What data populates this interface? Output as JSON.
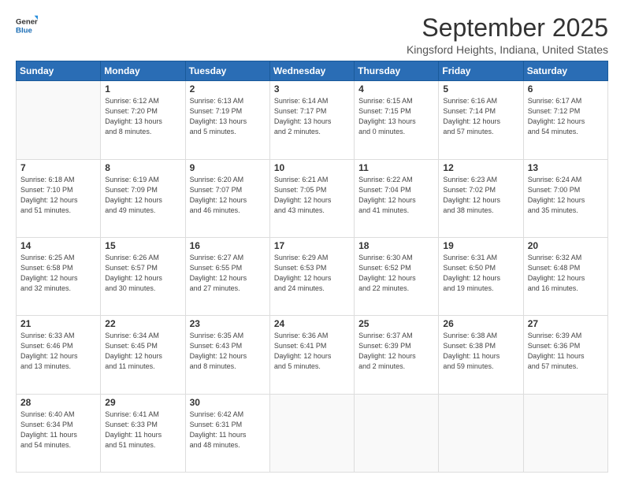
{
  "header": {
    "logo_line1": "General",
    "logo_line2": "Blue",
    "month": "September 2025",
    "location": "Kingsford Heights, Indiana, United States"
  },
  "weekdays": [
    "Sunday",
    "Monday",
    "Tuesday",
    "Wednesday",
    "Thursday",
    "Friday",
    "Saturday"
  ],
  "weeks": [
    [
      {
        "day": "",
        "info": ""
      },
      {
        "day": "1",
        "info": "Sunrise: 6:12 AM\nSunset: 7:20 PM\nDaylight: 13 hours\nand 8 minutes."
      },
      {
        "day": "2",
        "info": "Sunrise: 6:13 AM\nSunset: 7:19 PM\nDaylight: 13 hours\nand 5 minutes."
      },
      {
        "day": "3",
        "info": "Sunrise: 6:14 AM\nSunset: 7:17 PM\nDaylight: 13 hours\nand 2 minutes."
      },
      {
        "day": "4",
        "info": "Sunrise: 6:15 AM\nSunset: 7:15 PM\nDaylight: 13 hours\nand 0 minutes."
      },
      {
        "day": "5",
        "info": "Sunrise: 6:16 AM\nSunset: 7:14 PM\nDaylight: 12 hours\nand 57 minutes."
      },
      {
        "day": "6",
        "info": "Sunrise: 6:17 AM\nSunset: 7:12 PM\nDaylight: 12 hours\nand 54 minutes."
      }
    ],
    [
      {
        "day": "7",
        "info": "Sunrise: 6:18 AM\nSunset: 7:10 PM\nDaylight: 12 hours\nand 51 minutes."
      },
      {
        "day": "8",
        "info": "Sunrise: 6:19 AM\nSunset: 7:09 PM\nDaylight: 12 hours\nand 49 minutes."
      },
      {
        "day": "9",
        "info": "Sunrise: 6:20 AM\nSunset: 7:07 PM\nDaylight: 12 hours\nand 46 minutes."
      },
      {
        "day": "10",
        "info": "Sunrise: 6:21 AM\nSunset: 7:05 PM\nDaylight: 12 hours\nand 43 minutes."
      },
      {
        "day": "11",
        "info": "Sunrise: 6:22 AM\nSunset: 7:04 PM\nDaylight: 12 hours\nand 41 minutes."
      },
      {
        "day": "12",
        "info": "Sunrise: 6:23 AM\nSunset: 7:02 PM\nDaylight: 12 hours\nand 38 minutes."
      },
      {
        "day": "13",
        "info": "Sunrise: 6:24 AM\nSunset: 7:00 PM\nDaylight: 12 hours\nand 35 minutes."
      }
    ],
    [
      {
        "day": "14",
        "info": "Sunrise: 6:25 AM\nSunset: 6:58 PM\nDaylight: 12 hours\nand 32 minutes."
      },
      {
        "day": "15",
        "info": "Sunrise: 6:26 AM\nSunset: 6:57 PM\nDaylight: 12 hours\nand 30 minutes."
      },
      {
        "day": "16",
        "info": "Sunrise: 6:27 AM\nSunset: 6:55 PM\nDaylight: 12 hours\nand 27 minutes."
      },
      {
        "day": "17",
        "info": "Sunrise: 6:29 AM\nSunset: 6:53 PM\nDaylight: 12 hours\nand 24 minutes."
      },
      {
        "day": "18",
        "info": "Sunrise: 6:30 AM\nSunset: 6:52 PM\nDaylight: 12 hours\nand 22 minutes."
      },
      {
        "day": "19",
        "info": "Sunrise: 6:31 AM\nSunset: 6:50 PM\nDaylight: 12 hours\nand 19 minutes."
      },
      {
        "day": "20",
        "info": "Sunrise: 6:32 AM\nSunset: 6:48 PM\nDaylight: 12 hours\nand 16 minutes."
      }
    ],
    [
      {
        "day": "21",
        "info": "Sunrise: 6:33 AM\nSunset: 6:46 PM\nDaylight: 12 hours\nand 13 minutes."
      },
      {
        "day": "22",
        "info": "Sunrise: 6:34 AM\nSunset: 6:45 PM\nDaylight: 12 hours\nand 11 minutes."
      },
      {
        "day": "23",
        "info": "Sunrise: 6:35 AM\nSunset: 6:43 PM\nDaylight: 12 hours\nand 8 minutes."
      },
      {
        "day": "24",
        "info": "Sunrise: 6:36 AM\nSunset: 6:41 PM\nDaylight: 12 hours\nand 5 minutes."
      },
      {
        "day": "25",
        "info": "Sunrise: 6:37 AM\nSunset: 6:39 PM\nDaylight: 12 hours\nand 2 minutes."
      },
      {
        "day": "26",
        "info": "Sunrise: 6:38 AM\nSunset: 6:38 PM\nDaylight: 11 hours\nand 59 minutes."
      },
      {
        "day": "27",
        "info": "Sunrise: 6:39 AM\nSunset: 6:36 PM\nDaylight: 11 hours\nand 57 minutes."
      }
    ],
    [
      {
        "day": "28",
        "info": "Sunrise: 6:40 AM\nSunset: 6:34 PM\nDaylight: 11 hours\nand 54 minutes."
      },
      {
        "day": "29",
        "info": "Sunrise: 6:41 AM\nSunset: 6:33 PM\nDaylight: 11 hours\nand 51 minutes."
      },
      {
        "day": "30",
        "info": "Sunrise: 6:42 AM\nSunset: 6:31 PM\nDaylight: 11 hours\nand 48 minutes."
      },
      {
        "day": "",
        "info": ""
      },
      {
        "day": "",
        "info": ""
      },
      {
        "day": "",
        "info": ""
      },
      {
        "day": "",
        "info": ""
      }
    ]
  ]
}
